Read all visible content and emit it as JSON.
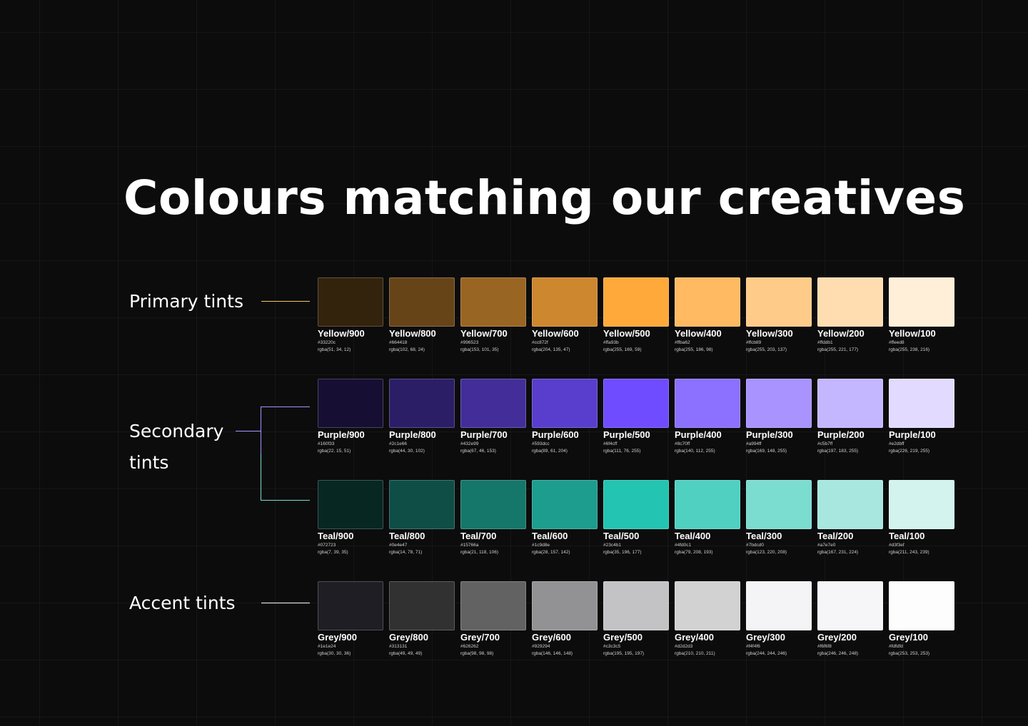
{
  "title": "Colours matching our creatives",
  "groups": {
    "primary": {
      "label": "Primary tints",
      "line_color": "#f5c66b"
    },
    "secondary": {
      "label_line1": "Secondary",
      "label_line2": "tints",
      "line_color_top": "#a794ff",
      "line_color_bottom": "#7fdccf"
    },
    "accent": {
      "label": "Accent tints",
      "line_color": "#ffffff"
    }
  },
  "rows": [
    {
      "id": "yellow",
      "swatches": [
        {
          "name": "Yellow/900",
          "hex": "#33220c",
          "rgba": "rgba(51, 34, 12)"
        },
        {
          "name": "Yellow/800",
          "hex": "#664418",
          "rgba": "rgba(102, 68, 24)"
        },
        {
          "name": "Yellow/700",
          "hex": "#996523",
          "rgba": "rgba(153, 101, 35)"
        },
        {
          "name": "Yellow/600",
          "hex": "#cc872f",
          "rgba": "rgba(204, 135, 47)"
        },
        {
          "name": "Yellow/500",
          "hex": "#ffa93b",
          "rgba": "rgba(255, 169, 59)"
        },
        {
          "name": "Yellow/400",
          "hex": "#ffba62",
          "rgba": "rgba(255, 186, 98)"
        },
        {
          "name": "Yellow/300",
          "hex": "#ffcb89",
          "rgba": "rgba(255, 203, 137)"
        },
        {
          "name": "Yellow/200",
          "hex": "#ffddb1",
          "rgba": "rgba(255, 221, 177)"
        },
        {
          "name": "Yellow/100",
          "hex": "#ffeed8",
          "rgba": "rgba(255, 238, 216)"
        }
      ]
    },
    {
      "id": "purple",
      "swatches": [
        {
          "name": "Purple/900",
          "hex": "#160f33",
          "rgba": "rgba(22, 15, 51)"
        },
        {
          "name": "Purple/800",
          "hex": "#2c1e66",
          "rgba": "rgba(44, 30, 102)"
        },
        {
          "name": "Purple/700",
          "hex": "#432e99",
          "rgba": "rgba(67, 46, 153)"
        },
        {
          "name": "Purple/600",
          "hex": "#593dcc",
          "rgba": "rgba(89, 61, 204)"
        },
        {
          "name": "Purple/500",
          "hex": "#6f4cff",
          "rgba": "rgba(111, 76, 255)"
        },
        {
          "name": "Purple/400",
          "hex": "#8c70ff",
          "rgba": "rgba(140, 112, 255)"
        },
        {
          "name": "Purple/300",
          "hex": "#a994ff",
          "rgba": "rgba(169, 148, 255)"
        },
        {
          "name": "Purple/200",
          "hex": "#c5b7ff",
          "rgba": "rgba(197, 183, 255)"
        },
        {
          "name": "Purple/100",
          "hex": "#e2dbff",
          "rgba": "rgba(226, 219, 255)"
        }
      ]
    },
    {
      "id": "teal",
      "swatches": [
        {
          "name": "Teal/900",
          "hex": "#072723",
          "rgba": "rgba(7, 39, 35)"
        },
        {
          "name": "Teal/800",
          "hex": "#0e4e47",
          "rgba": "rgba(14, 78, 71)"
        },
        {
          "name": "Teal/700",
          "hex": "#15766a",
          "rgba": "rgba(21, 118, 106)"
        },
        {
          "name": "Teal/600",
          "hex": "#1c9d8e",
          "rgba": "rgba(28, 157, 142)"
        },
        {
          "name": "Teal/500",
          "hex": "#23c4b1",
          "rgba": "rgba(35, 196, 177)"
        },
        {
          "name": "Teal/400",
          "hex": "#4fd0c1",
          "rgba": "rgba(79, 208, 193)"
        },
        {
          "name": "Teal/300",
          "hex": "#7bdcd0",
          "rgba": "rgba(123, 220, 208)"
        },
        {
          "name": "Teal/200",
          "hex": "#a7e7e0",
          "rgba": "rgba(167, 231, 224)"
        },
        {
          "name": "Teal/100",
          "hex": "#d3f3ef",
          "rgba": "rgba(211, 243, 239)"
        }
      ]
    },
    {
      "id": "grey",
      "swatches": [
        {
          "name": "Grey/900",
          "hex": "#1e1e24",
          "rgba": "rgba(30, 30, 36)"
        },
        {
          "name": "Grey/800",
          "hex": "#313131",
          "rgba": "rgba(49, 49, 49)"
        },
        {
          "name": "Grey/700",
          "hex": "#626262",
          "rgba": "rgba(98, 98, 98)"
        },
        {
          "name": "Grey/600",
          "hex": "#929294",
          "rgba": "rgba(146, 146, 148)"
        },
        {
          "name": "Grey/500",
          "hex": "#c3c3c5",
          "rgba": "rgba(195, 195, 197)"
        },
        {
          "name": "Grey/400",
          "hex": "#d2d2d3",
          "rgba": "rgba(210, 210, 211)"
        },
        {
          "name": "Grey/300",
          "hex": "#f4f4f6",
          "rgba": "rgba(244, 244, 246)"
        },
        {
          "name": "Grey/200",
          "hex": "#f6f6f8",
          "rgba": "rgba(246, 246, 248)"
        },
        {
          "name": "Grey/100",
          "hex": "#fdfdfd",
          "rgba": "rgba(253, 253, 253)"
        }
      ]
    }
  ]
}
